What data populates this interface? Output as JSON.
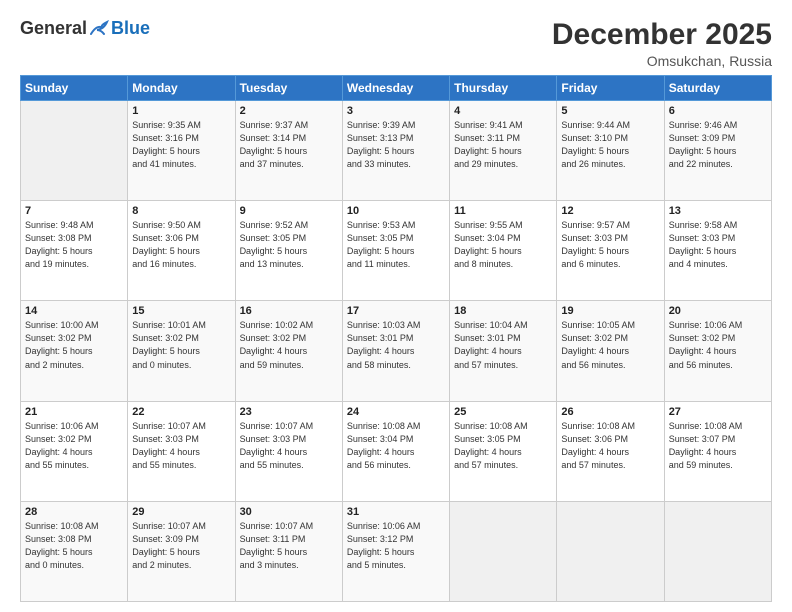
{
  "logo": {
    "general": "General",
    "blue": "Blue"
  },
  "header": {
    "month": "December 2025",
    "location": "Omsukchan, Russia"
  },
  "weekdays": [
    "Sunday",
    "Monday",
    "Tuesday",
    "Wednesday",
    "Thursday",
    "Friday",
    "Saturday"
  ],
  "weeks": [
    [
      {
        "day": "",
        "info": ""
      },
      {
        "day": "1",
        "info": "Sunrise: 9:35 AM\nSunset: 3:16 PM\nDaylight: 5 hours\nand 41 minutes."
      },
      {
        "day": "2",
        "info": "Sunrise: 9:37 AM\nSunset: 3:14 PM\nDaylight: 5 hours\nand 37 minutes."
      },
      {
        "day": "3",
        "info": "Sunrise: 9:39 AM\nSunset: 3:13 PM\nDaylight: 5 hours\nand 33 minutes."
      },
      {
        "day": "4",
        "info": "Sunrise: 9:41 AM\nSunset: 3:11 PM\nDaylight: 5 hours\nand 29 minutes."
      },
      {
        "day": "5",
        "info": "Sunrise: 9:44 AM\nSunset: 3:10 PM\nDaylight: 5 hours\nand 26 minutes."
      },
      {
        "day": "6",
        "info": "Sunrise: 9:46 AM\nSunset: 3:09 PM\nDaylight: 5 hours\nand 22 minutes."
      }
    ],
    [
      {
        "day": "7",
        "info": "Sunrise: 9:48 AM\nSunset: 3:08 PM\nDaylight: 5 hours\nand 19 minutes."
      },
      {
        "day": "8",
        "info": "Sunrise: 9:50 AM\nSunset: 3:06 PM\nDaylight: 5 hours\nand 16 minutes."
      },
      {
        "day": "9",
        "info": "Sunrise: 9:52 AM\nSunset: 3:05 PM\nDaylight: 5 hours\nand 13 minutes."
      },
      {
        "day": "10",
        "info": "Sunrise: 9:53 AM\nSunset: 3:05 PM\nDaylight: 5 hours\nand 11 minutes."
      },
      {
        "day": "11",
        "info": "Sunrise: 9:55 AM\nSunset: 3:04 PM\nDaylight: 5 hours\nand 8 minutes."
      },
      {
        "day": "12",
        "info": "Sunrise: 9:57 AM\nSunset: 3:03 PM\nDaylight: 5 hours\nand 6 minutes."
      },
      {
        "day": "13",
        "info": "Sunrise: 9:58 AM\nSunset: 3:03 PM\nDaylight: 5 hours\nand 4 minutes."
      }
    ],
    [
      {
        "day": "14",
        "info": "Sunrise: 10:00 AM\nSunset: 3:02 PM\nDaylight: 5 hours\nand 2 minutes."
      },
      {
        "day": "15",
        "info": "Sunrise: 10:01 AM\nSunset: 3:02 PM\nDaylight: 5 hours\nand 0 minutes."
      },
      {
        "day": "16",
        "info": "Sunrise: 10:02 AM\nSunset: 3:02 PM\nDaylight: 4 hours\nand 59 minutes."
      },
      {
        "day": "17",
        "info": "Sunrise: 10:03 AM\nSunset: 3:01 PM\nDaylight: 4 hours\nand 58 minutes."
      },
      {
        "day": "18",
        "info": "Sunrise: 10:04 AM\nSunset: 3:01 PM\nDaylight: 4 hours\nand 57 minutes."
      },
      {
        "day": "19",
        "info": "Sunrise: 10:05 AM\nSunset: 3:02 PM\nDaylight: 4 hours\nand 56 minutes."
      },
      {
        "day": "20",
        "info": "Sunrise: 10:06 AM\nSunset: 3:02 PM\nDaylight: 4 hours\nand 56 minutes."
      }
    ],
    [
      {
        "day": "21",
        "info": "Sunrise: 10:06 AM\nSunset: 3:02 PM\nDaylight: 4 hours\nand 55 minutes."
      },
      {
        "day": "22",
        "info": "Sunrise: 10:07 AM\nSunset: 3:03 PM\nDaylight: 4 hours\nand 55 minutes."
      },
      {
        "day": "23",
        "info": "Sunrise: 10:07 AM\nSunset: 3:03 PM\nDaylight: 4 hours\nand 55 minutes."
      },
      {
        "day": "24",
        "info": "Sunrise: 10:08 AM\nSunset: 3:04 PM\nDaylight: 4 hours\nand 56 minutes."
      },
      {
        "day": "25",
        "info": "Sunrise: 10:08 AM\nSunset: 3:05 PM\nDaylight: 4 hours\nand 57 minutes."
      },
      {
        "day": "26",
        "info": "Sunrise: 10:08 AM\nSunset: 3:06 PM\nDaylight: 4 hours\nand 57 minutes."
      },
      {
        "day": "27",
        "info": "Sunrise: 10:08 AM\nSunset: 3:07 PM\nDaylight: 4 hours\nand 59 minutes."
      }
    ],
    [
      {
        "day": "28",
        "info": "Sunrise: 10:08 AM\nSunset: 3:08 PM\nDaylight: 5 hours\nand 0 minutes."
      },
      {
        "day": "29",
        "info": "Sunrise: 10:07 AM\nSunset: 3:09 PM\nDaylight: 5 hours\nand 2 minutes."
      },
      {
        "day": "30",
        "info": "Sunrise: 10:07 AM\nSunset: 3:11 PM\nDaylight: 5 hours\nand 3 minutes."
      },
      {
        "day": "31",
        "info": "Sunrise: 10:06 AM\nSunset: 3:12 PM\nDaylight: 5 hours\nand 5 minutes."
      },
      {
        "day": "",
        "info": ""
      },
      {
        "day": "",
        "info": ""
      },
      {
        "day": "",
        "info": ""
      }
    ]
  ]
}
